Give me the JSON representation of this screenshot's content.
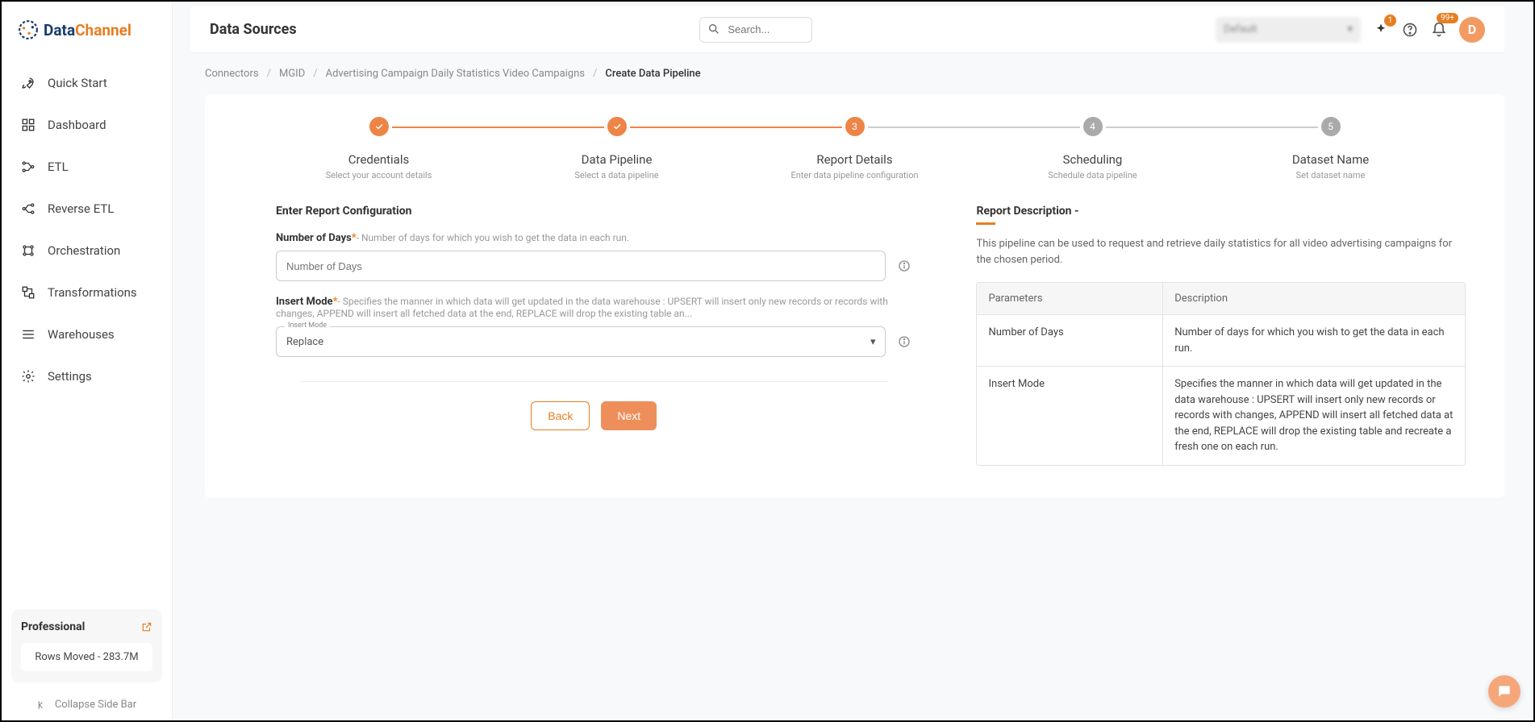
{
  "brand": {
    "name1": "Data",
    "name2": "Channel"
  },
  "sidebar": {
    "items": [
      {
        "label": "Quick Start"
      },
      {
        "label": "Dashboard"
      },
      {
        "label": "ETL"
      },
      {
        "label": "Reverse ETL"
      },
      {
        "label": "Orchestration"
      },
      {
        "label": "Transformations"
      },
      {
        "label": "Warehouses"
      },
      {
        "label": "Settings"
      }
    ],
    "plan": {
      "name": "Professional",
      "rows": "Rows Moved - 283.7M"
    },
    "collapse": "Collapse Side Bar"
  },
  "header": {
    "title": "Data Sources",
    "search_placeholder": "Search...",
    "org": "Default",
    "sparkle_badge": "1",
    "bell_badge": "99+",
    "avatar": "D"
  },
  "breadcrumb": {
    "items": [
      "Connectors",
      "MGID",
      "Advertising Campaign Daily Statistics Video Campaigns"
    ],
    "current": "Create Data Pipeline"
  },
  "stepper": [
    {
      "title": "Credentials",
      "sub": "Select your account details",
      "state": "done"
    },
    {
      "title": "Data Pipeline",
      "sub": "Select a data pipeline",
      "state": "done"
    },
    {
      "title": "Report Details",
      "sub": "Enter data pipeline configuration",
      "state": "current",
      "num": "3"
    },
    {
      "title": "Scheduling",
      "sub": "Schedule data pipeline",
      "state": "todo",
      "num": "4"
    },
    {
      "title": "Dataset Name",
      "sub": "Set dataset name",
      "state": "todo",
      "num": "5"
    }
  ],
  "form": {
    "section_title": "Enter Report Configuration",
    "fields": {
      "days": {
        "label": "Number of Days",
        "hint": "- Number of days for which you wish to get the data in each run.",
        "placeholder": "Number of Days"
      },
      "mode": {
        "label": "Insert Mode",
        "hint": "- Specifies the manner in which data will get updated in the data warehouse : UPSERT will insert only new records or records with changes, APPEND will insert all fetched data at the end, REPLACE will drop the existing table an...",
        "float": "Insert Mode",
        "value": "Replace"
      }
    },
    "buttons": {
      "back": "Back",
      "next": "Next"
    }
  },
  "description": {
    "title": "Report Description -",
    "text": "This pipeline can be used to request and retrieve daily statistics for all video advertising campaigns for the chosen period.",
    "table": {
      "headers": [
        "Parameters",
        "Description"
      ],
      "rows": [
        {
          "p": "Number of Days",
          "d": "Number of days for which you wish to get the data in each run."
        },
        {
          "p": "Insert Mode",
          "d": "Specifies the manner in which data will get updated in the data warehouse : UPSERT will insert only new records or records with changes, APPEND will insert all fetched data at the end, REPLACE will drop the existing table and recreate a fresh one on each run."
        }
      ]
    }
  }
}
